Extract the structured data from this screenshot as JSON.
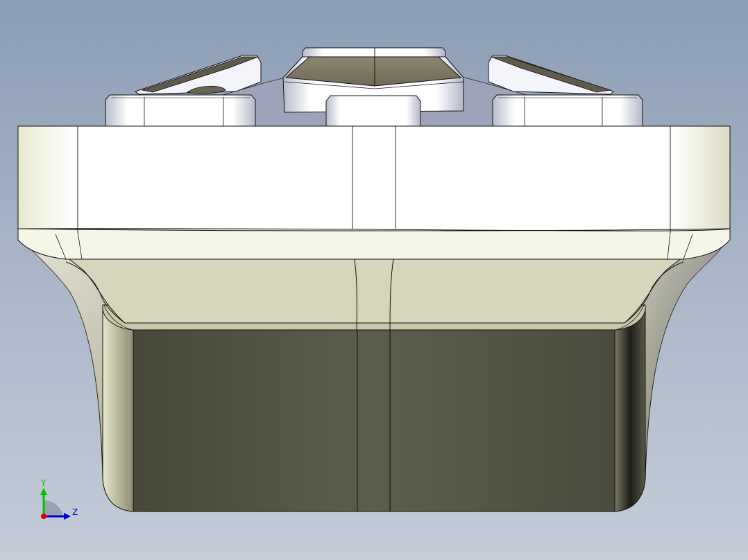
{
  "viewport": {
    "background_top": "#8c9db5",
    "background_bottom": "#c4ccd8"
  },
  "model": {
    "part_face_light": "#fdfdf7",
    "part_face_shadow": "#5a5b4a",
    "edge_color": "#000000"
  },
  "triad": {
    "y_label": "Y",
    "z_label": "Z",
    "y_color": "#00c000",
    "z_color": "#0000e0",
    "x_color": "#e00000"
  }
}
